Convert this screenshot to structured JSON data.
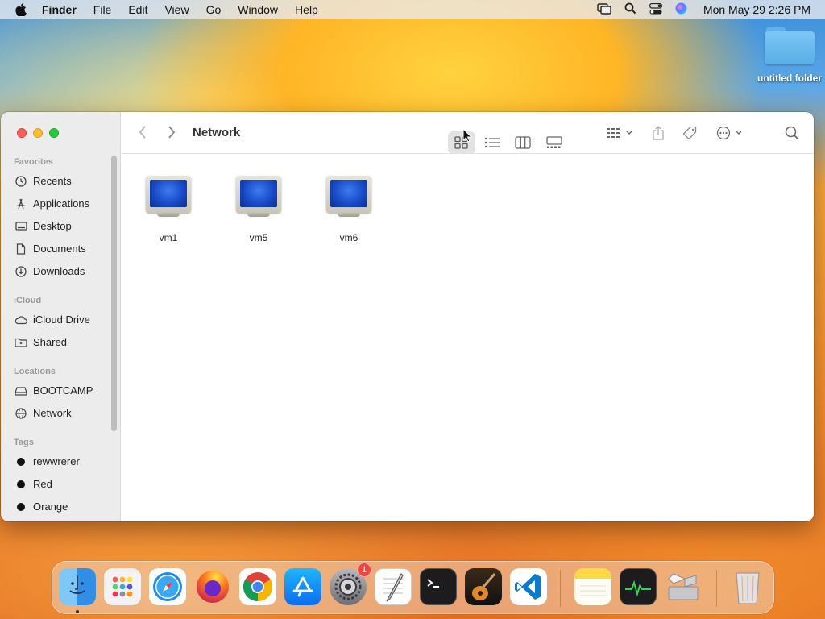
{
  "menubar": {
    "app_name": "Finder",
    "items": [
      "File",
      "Edit",
      "View",
      "Go",
      "Window",
      "Help"
    ],
    "clock": "Mon May 29  2:26 PM"
  },
  "desktop": {
    "folder_label": "untitled folder"
  },
  "window": {
    "title": "Network",
    "sidebar": {
      "favorites_header": "Favorites",
      "favorites": [
        "Recents",
        "Applications",
        "Desktop",
        "Documents",
        "Downloads"
      ],
      "icloud_header": "iCloud",
      "icloud": [
        "iCloud Drive",
        "Shared"
      ],
      "locations_header": "Locations",
      "locations": [
        "BOOTCAMP",
        "Network"
      ],
      "tags_header": "Tags",
      "tags": [
        "rewwrerer",
        "Red",
        "Orange"
      ]
    },
    "items": [
      "vm1",
      "vm5",
      "vm6"
    ]
  },
  "dock": {
    "apps": [
      "Finder",
      "Launchpad",
      "Safari",
      "Firefox",
      "Chrome",
      "App Store",
      "System Settings",
      "TextEdit",
      "Terminal",
      "GarageBand",
      "Visual Studio Code",
      "Notes",
      "Activity Monitor",
      "Boot Camp Assistant",
      "Trash"
    ],
    "settings_badge": "1"
  }
}
